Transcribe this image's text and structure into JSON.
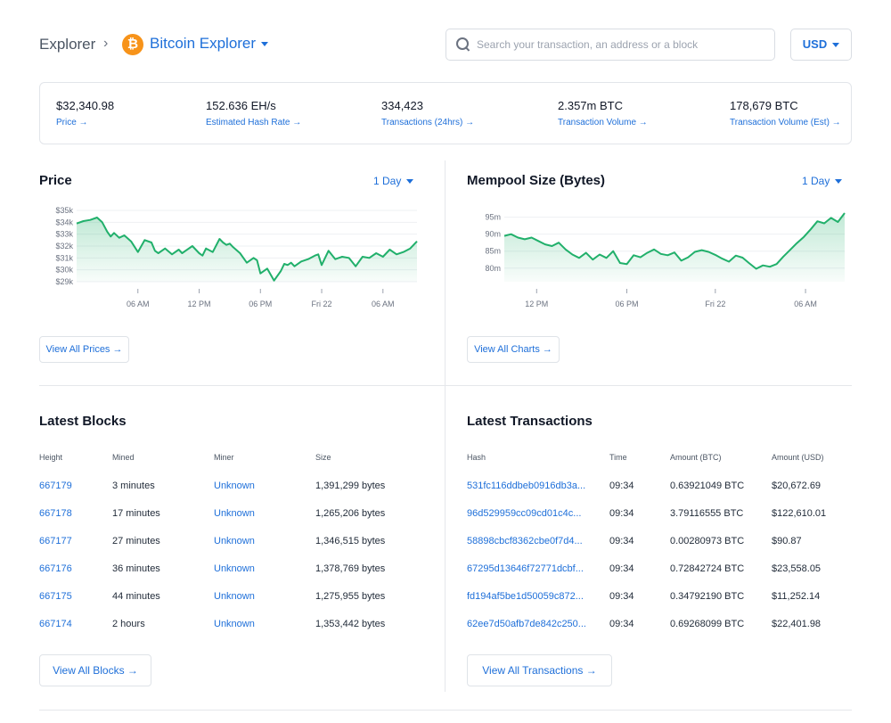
{
  "header": {
    "crumb_root": "Explorer",
    "crumb_sep": "›",
    "logo_glyph": "₿",
    "crumb_current": "Bitcoin Explorer",
    "search_placeholder": "Search your transaction, an address or a block",
    "currency": "USD"
  },
  "stats": [
    {
      "value": "$32,340.98",
      "label": "Price →"
    },
    {
      "value": "152.636 EH/s",
      "label": "Estimated Hash Rate →"
    },
    {
      "value": "334,423",
      "label": "Transactions (24hrs) →"
    },
    {
      "value": "2.357m BTC",
      "label": "Transaction Volume →"
    },
    {
      "value": "178,679 BTC",
      "label": "Transaction Volume (Est) →"
    }
  ],
  "price_panel": {
    "title": "Price",
    "range": "1 Day",
    "button": "View All Prices →"
  },
  "mempool_panel": {
    "title": "Mempool Size (Bytes)",
    "range": "1 Day",
    "button": "View All Charts →"
  },
  "colors": {
    "accent": "#1e6fd9",
    "chart_line": "#21b06b",
    "bitcoin_orange": "#f7931a"
  },
  "chart_data": [
    {
      "type": "area",
      "ylim": [
        29,
        35
      ],
      "y_ticks": [
        "$35k",
        "$34k",
        "$33k",
        "$32k",
        "$31k",
        "$30k",
        "$29k"
      ],
      "y_tick_values": [
        35,
        34,
        33,
        32,
        31,
        30,
        29
      ],
      "x_ticks": [
        "06 AM",
        "12 PM",
        "06 PM",
        "Fri 22",
        "06 AM"
      ],
      "x_tick_positions": [
        0.18,
        0.36,
        0.54,
        0.72,
        0.9
      ],
      "x": [
        0,
        0.02,
        0.04,
        0.06,
        0.075,
        0.09,
        0.1,
        0.11,
        0.125,
        0.14,
        0.16,
        0.18,
        0.2,
        0.22,
        0.23,
        0.24,
        0.26,
        0.28,
        0.3,
        0.31,
        0.32,
        0.34,
        0.36,
        0.37,
        0.38,
        0.4,
        0.42,
        0.43,
        0.44,
        0.45,
        0.46,
        0.48,
        0.5,
        0.52,
        0.53,
        0.54,
        0.56,
        0.58,
        0.6,
        0.61,
        0.62,
        0.63,
        0.64,
        0.66,
        0.68,
        0.7,
        0.71,
        0.72,
        0.74,
        0.76,
        0.78,
        0.8,
        0.82,
        0.84,
        0.86,
        0.88,
        0.9,
        0.92,
        0.94,
        0.96,
        0.98,
        1.0
      ],
      "y": [
        33.9,
        34.1,
        34.2,
        34.4,
        34.0,
        33.2,
        32.8,
        33.1,
        32.7,
        32.9,
        32.4,
        31.5,
        32.5,
        32.3,
        31.6,
        31.4,
        31.8,
        31.3,
        31.7,
        31.4,
        31.6,
        32.0,
        31.4,
        31.2,
        31.8,
        31.5,
        32.6,
        32.3,
        32.1,
        32.2,
        31.9,
        31.4,
        30.6,
        31.0,
        30.8,
        29.7,
        30.1,
        29.1,
        29.9,
        30.5,
        30.4,
        30.6,
        30.3,
        30.7,
        30.9,
        31.2,
        31.3,
        30.4,
        31.6,
        30.9,
        31.1,
        31.0,
        30.3,
        31.1,
        31.0,
        31.4,
        31.1,
        31.7,
        31.3,
        31.5,
        31.8,
        32.4
      ]
    },
    {
      "type": "area",
      "ylim": [
        76,
        97
      ],
      "y_ticks": [
        "95m",
        "90m",
        "85m",
        "80m"
      ],
      "y_tick_values": [
        95,
        90,
        85,
        80
      ],
      "x_ticks": [
        "12 PM",
        "06 PM",
        "Fri 22",
        "06 AM"
      ],
      "x_tick_positions": [
        0.095,
        0.36,
        0.62,
        0.885
      ],
      "x": [
        0,
        0.02,
        0.04,
        0.06,
        0.08,
        0.1,
        0.12,
        0.14,
        0.16,
        0.18,
        0.2,
        0.22,
        0.24,
        0.26,
        0.28,
        0.3,
        0.32,
        0.34,
        0.36,
        0.38,
        0.4,
        0.42,
        0.44,
        0.46,
        0.48,
        0.5,
        0.52,
        0.54,
        0.56,
        0.58,
        0.6,
        0.62,
        0.64,
        0.66,
        0.68,
        0.7,
        0.72,
        0.74,
        0.76,
        0.78,
        0.8,
        0.82,
        0.84,
        0.86,
        0.88,
        0.9,
        0.92,
        0.94,
        0.96,
        0.98,
        1.0
      ],
      "y": [
        89.5,
        90,
        89,
        88.5,
        89,
        88,
        87,
        86.5,
        87.5,
        85.5,
        84,
        83,
        84.5,
        82.5,
        84,
        83,
        85,
        81.5,
        81.2,
        83.8,
        83.2,
        84.5,
        85.5,
        84.2,
        83.8,
        84.6,
        82.2,
        83.2,
        84.8,
        85.3,
        84.8,
        83.9,
        82.8,
        81.9,
        83.7,
        83.1,
        81.4,
        79.8,
        80.8,
        80.4,
        81.2,
        83.4,
        85.4,
        87.4,
        89.2,
        91.4,
        93.8,
        93.2,
        94.8,
        93.6,
        96.2
      ]
    }
  ],
  "blocks": {
    "title": "Latest Blocks",
    "headers": [
      "Height",
      "Mined",
      "Miner",
      "Size"
    ],
    "rows": [
      [
        "667179",
        "3 minutes",
        "Unknown",
        "1,391,299 bytes"
      ],
      [
        "667178",
        "17 minutes",
        "Unknown",
        "1,265,206 bytes"
      ],
      [
        "667177",
        "27 minutes",
        "Unknown",
        "1,346,515 bytes"
      ],
      [
        "667176",
        "36 minutes",
        "Unknown",
        "1,378,769 bytes"
      ],
      [
        "667175",
        "44 minutes",
        "Unknown",
        "1,275,955 bytes"
      ],
      [
        "667174",
        "2 hours",
        "Unknown",
        "1,353,442 bytes"
      ]
    ],
    "button": "View All Blocks →"
  },
  "transactions": {
    "title": "Latest Transactions",
    "headers": [
      "Hash",
      "Time",
      "Amount (BTC)",
      "Amount (USD)"
    ],
    "rows": [
      [
        "531fc116ddbeb0916db3a...",
        "09:34",
        "0.63921049 BTC",
        "$20,672.69"
      ],
      [
        "96d529959cc09cd01c4c...",
        "09:34",
        "3.79116555 BTC",
        "$122,610.01"
      ],
      [
        "58898cbcf8362cbe0f7d4...",
        "09:34",
        "0.00280973 BTC",
        "$90.87"
      ],
      [
        "67295d13646f72771dcbf...",
        "09:34",
        "0.72842724 BTC",
        "$23,558.05"
      ],
      [
        "fd194af5be1d50059c872...",
        "09:34",
        "0.34792190 BTC",
        "$11,252.14"
      ],
      [
        "62ee7d50afb7de842c250...",
        "09:34",
        "0.69268099 BTC",
        "$22,401.98"
      ]
    ],
    "button": "View All Transactions →"
  }
}
